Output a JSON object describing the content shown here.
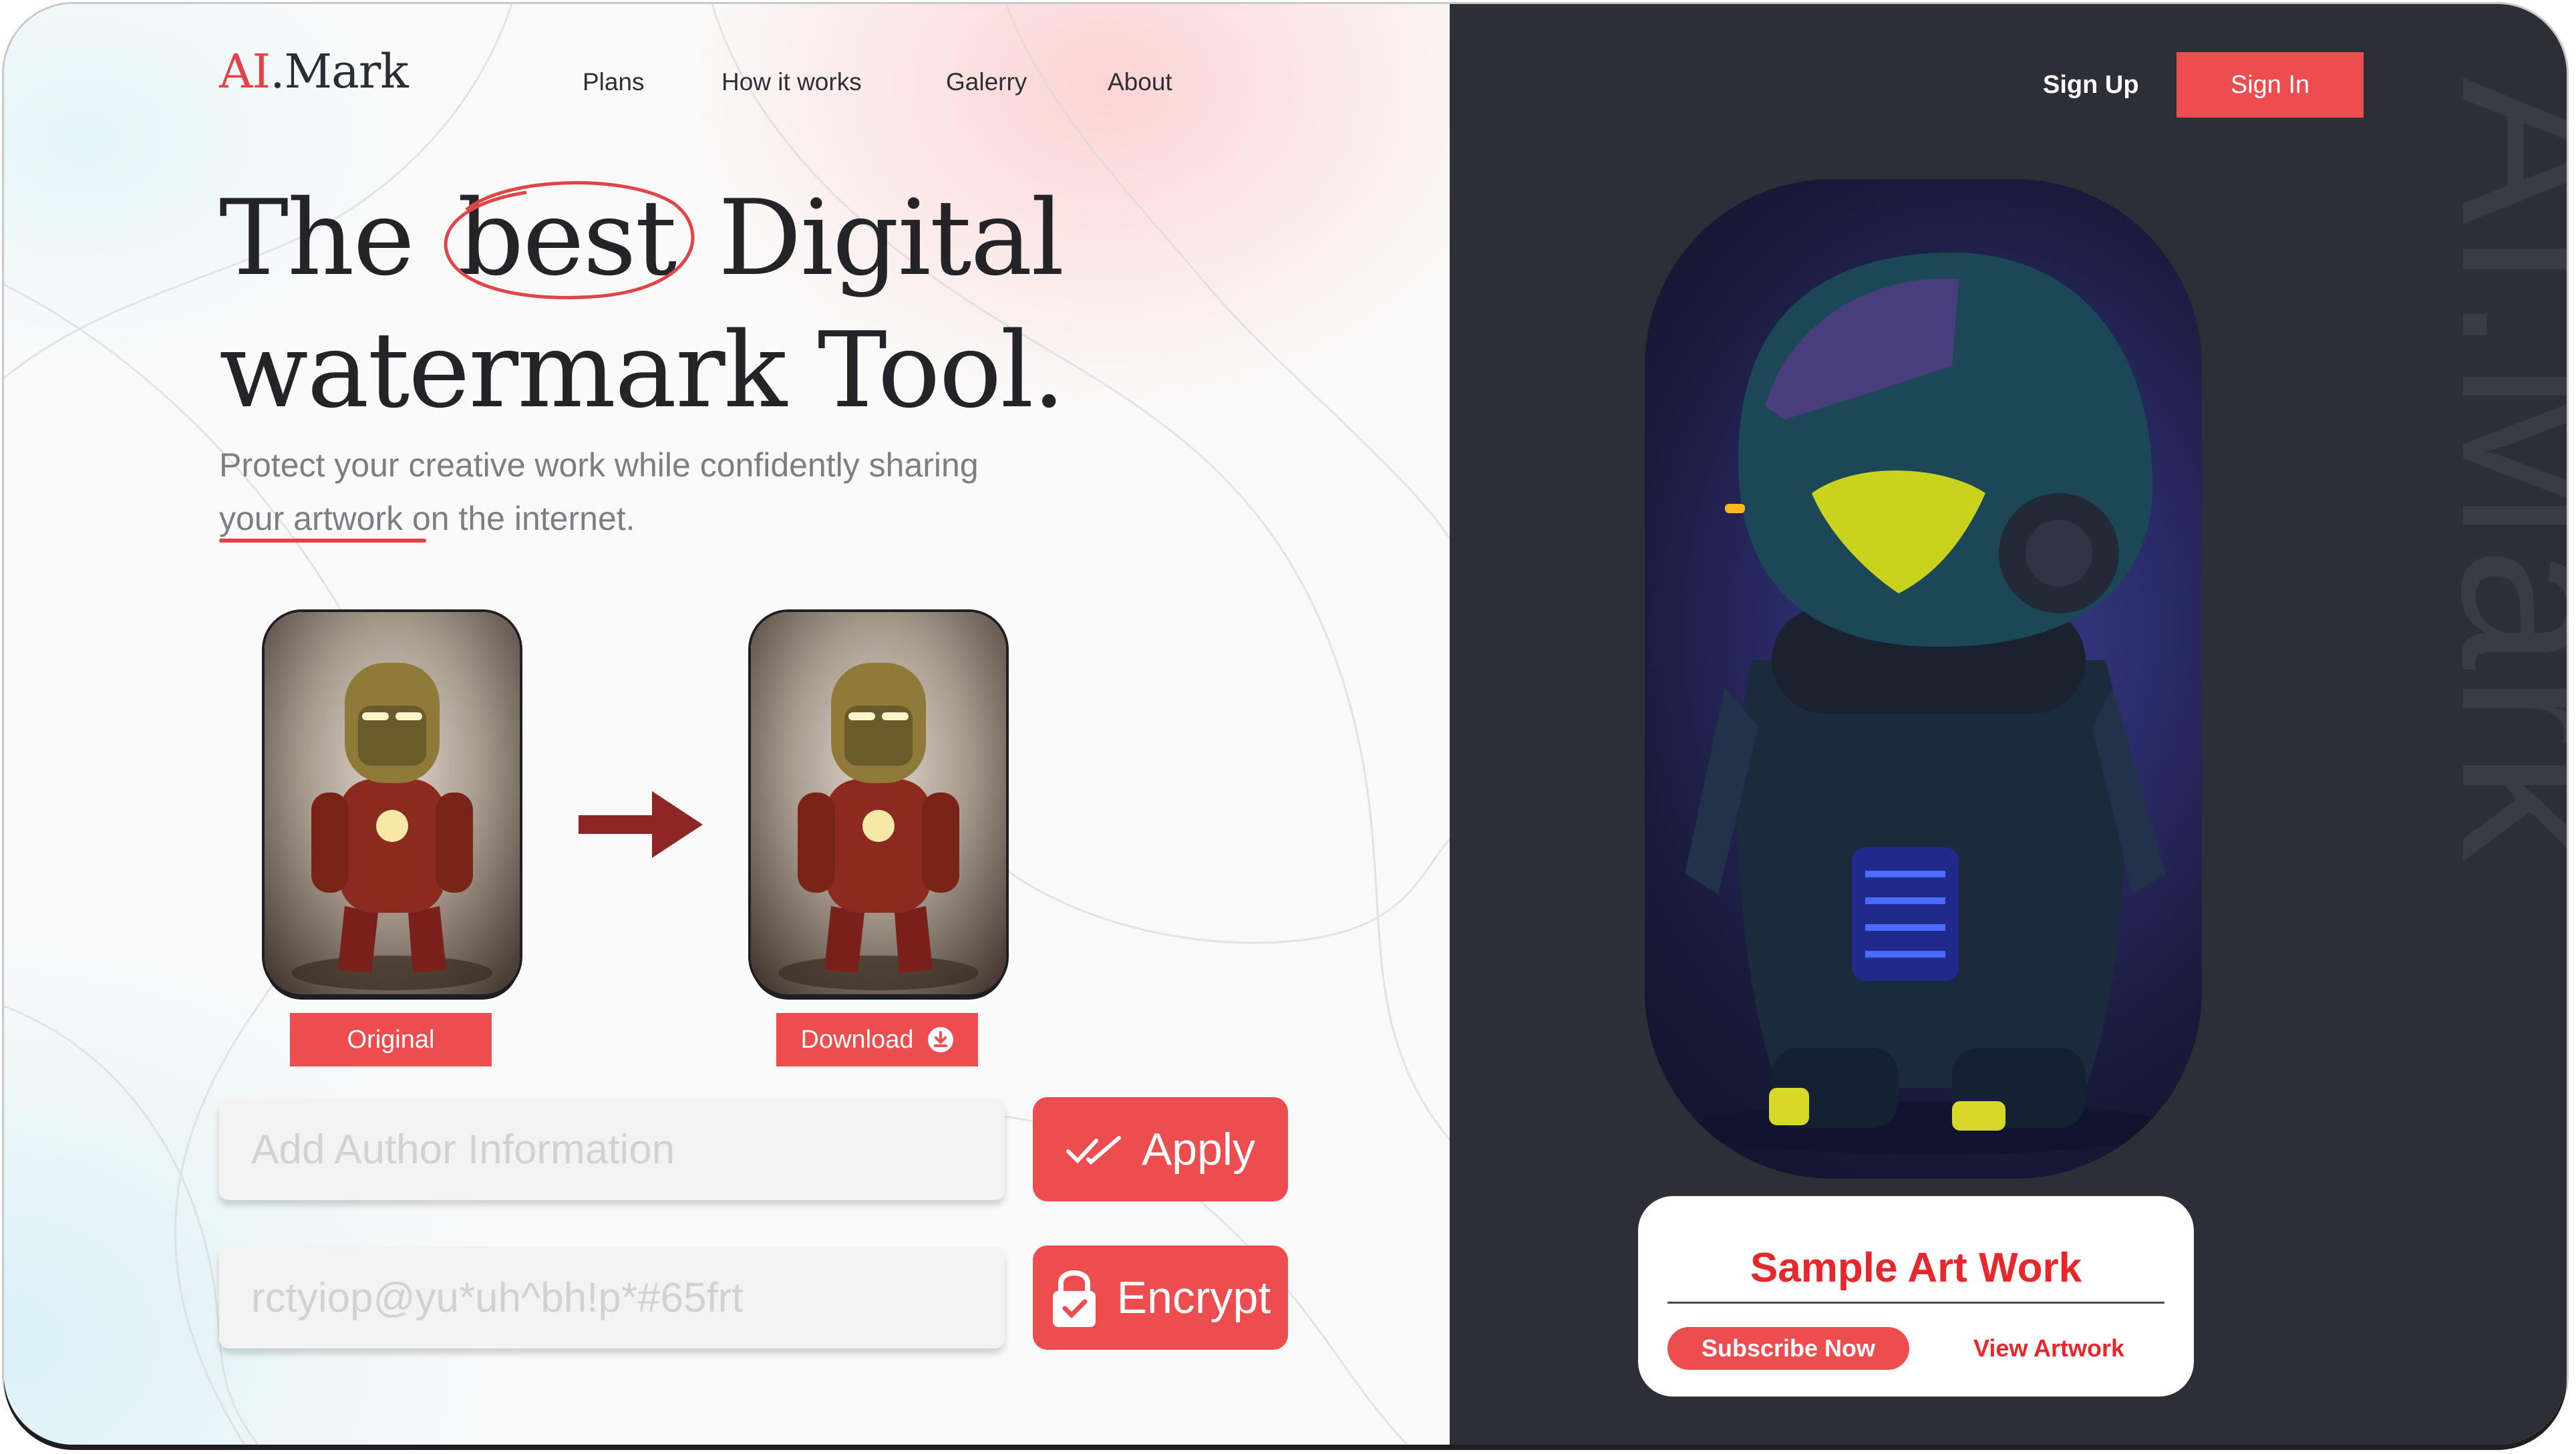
{
  "brand": {
    "logo_prefix": "AI",
    "logo_suffix": ".Mark",
    "vertical_watermark": "AI.Mark"
  },
  "nav": {
    "items": [
      "Plans",
      "How it works",
      "Galerry",
      "About"
    ]
  },
  "auth": {
    "sign_up": "Sign Up",
    "sign_in": "Sign In"
  },
  "hero": {
    "line1_word1": "The",
    "line1_word2": "best",
    "line1_word3": "Digital",
    "line2": "watermark Tool.",
    "subtitle_line1": "Protect your creative work while confidently sharing",
    "subtitle_line2": "your artwork on the internet."
  },
  "preview": {
    "original_label": "Original",
    "download_label": "Download"
  },
  "form": {
    "author_placeholder": "Add Author Information",
    "key_placeholder": "rctyiop@yu*uh^bh!p*#65frt",
    "apply_label": "Apply",
    "encrypt_label": "Encrypt"
  },
  "sample": {
    "title": "Sample Art Work",
    "subscribe_label": "Subscribe Now",
    "view_label": "View Artwork"
  },
  "colors": {
    "accent": "#ee4d4f",
    "dark_panel": "#2e2e36",
    "red_text": "#e6272c"
  },
  "icons": {
    "arrow": "arrow-right-icon",
    "download": "download-circle-icon",
    "apply": "double-check-icon",
    "encrypt": "lock-check-icon"
  }
}
